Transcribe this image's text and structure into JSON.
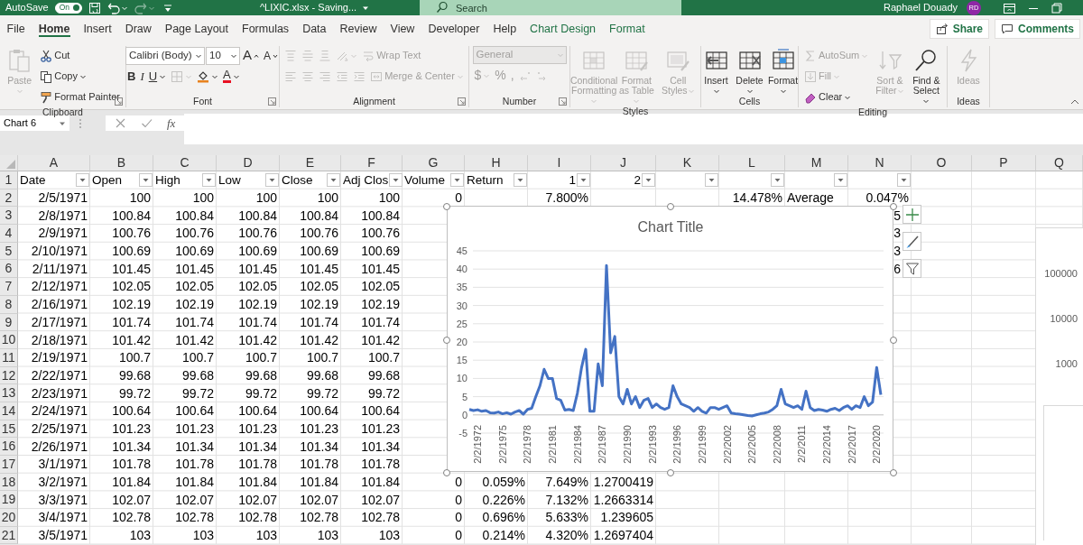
{
  "title_bar": {
    "autosave": {
      "label": "AutoSave",
      "on": true,
      "state_text": "On"
    },
    "quick_access": [
      {
        "kind": "save",
        "disabled": false,
        "dropdown": false
      },
      {
        "kind": "undo",
        "disabled": false,
        "dropdown": true
      },
      {
        "kind": "redo",
        "disabled": true,
        "dropdown": true
      },
      {
        "kind": "customize",
        "disabled": false,
        "dropdown": false
      }
    ],
    "title": "^LIXIC.xlsx - Saving...",
    "search": {
      "placeholder": "Search"
    },
    "user": {
      "name": "Raphael Douady",
      "initials": "RD"
    }
  },
  "tabs": [
    {
      "label": "File",
      "selected": false,
      "kind": "standard"
    },
    {
      "label": "Home",
      "selected": true,
      "kind": "standard"
    },
    {
      "label": "Insert",
      "selected": false,
      "kind": "standard"
    },
    {
      "label": "Draw",
      "selected": false,
      "kind": "standard"
    },
    {
      "label": "Page Layout",
      "selected": false,
      "kind": "standard"
    },
    {
      "label": "Formulas",
      "selected": false,
      "kind": "standard"
    },
    {
      "label": "Data",
      "selected": false,
      "kind": "standard"
    },
    {
      "label": "Review",
      "selected": false,
      "kind": "standard"
    },
    {
      "label": "View",
      "selected": false,
      "kind": "standard"
    },
    {
      "label": "Developer",
      "selected": false,
      "kind": "standard"
    },
    {
      "label": "Help",
      "selected": false,
      "kind": "standard"
    },
    {
      "label": "Chart Design",
      "selected": false,
      "kind": "contextual"
    },
    {
      "label": "Format",
      "selected": false,
      "kind": "contextual"
    }
  ],
  "tab_actions": [
    {
      "kind": "share",
      "label": "Share"
    },
    {
      "kind": "comments",
      "label": "Comments"
    }
  ],
  "ribbon": {
    "groups": [
      {
        "label": "Clipboard",
        "launcher": true,
        "items": [
          {
            "kind": "paste",
            "label": "Paste",
            "disabled": true,
            "dropdown": true
          },
          {
            "kind": "cut",
            "label": "Cut",
            "disabled": false,
            "dropdown": false
          },
          {
            "kind": "copy",
            "label": "Copy",
            "disabled": false,
            "dropdown": true
          },
          {
            "kind": "painter",
            "label": "Format Painter",
            "disabled": false,
            "dropdown": false
          }
        ]
      },
      {
        "label": "Font",
        "launcher": true,
        "items": [
          {
            "kind": "fontname",
            "label": "Calibri (Body)",
            "disabled": false,
            "dropdown": true
          },
          {
            "kind": "fontsize",
            "label": "10",
            "disabled": false,
            "dropdown": true
          },
          {
            "kind": "grow",
            "label": "A",
            "disabled": false,
            "dropdown": false
          },
          {
            "kind": "shrink",
            "label": "A",
            "disabled": false,
            "dropdown": false
          },
          {
            "kind": "bold",
            "label": "B",
            "disabled": false,
            "dropdown": false
          },
          {
            "kind": "italic",
            "label": "I",
            "disabled": false,
            "dropdown": false
          },
          {
            "kind": "underline",
            "label": "U",
            "disabled": false,
            "dropdown": true
          },
          {
            "kind": "borders",
            "disabled": true,
            "dropdown": true
          },
          {
            "kind": "fill",
            "disabled": false,
            "dropdown": true
          },
          {
            "kind": "fontcolor",
            "label": "A",
            "disabled": false,
            "dropdown": true
          }
        ]
      },
      {
        "label": "Alignment",
        "launcher": true,
        "items": [
          {
            "kind": "aligntop",
            "disabled": true,
            "dropdown": false
          },
          {
            "kind": "alignmiddle",
            "disabled": true,
            "dropdown": false
          },
          {
            "kind": "alignbottom",
            "disabled": true,
            "dropdown": false
          },
          {
            "kind": "orientation",
            "disabled": true,
            "dropdown": true
          },
          {
            "kind": "wrap",
            "label": "Wrap Text",
            "disabled": true,
            "dropdown": false
          },
          {
            "kind": "alignleft",
            "disabled": true,
            "dropdown": false
          },
          {
            "kind": "center",
            "disabled": true,
            "dropdown": false
          },
          {
            "kind": "alignright",
            "disabled": true,
            "dropdown": false
          },
          {
            "kind": "outdent",
            "disabled": true,
            "dropdown": false
          },
          {
            "kind": "indent",
            "disabled": true,
            "dropdown": false
          },
          {
            "kind": "merge",
            "label": "Merge & Center",
            "disabled": true,
            "dropdown": true
          }
        ]
      },
      {
        "label": "Number",
        "launcher": true,
        "items": [
          {
            "kind": "format",
            "label": "General",
            "disabled": true,
            "dropdown": true
          },
          {
            "kind": "currency",
            "label": "$",
            "disabled": true,
            "dropdown": true
          },
          {
            "kind": "percent",
            "label": "%",
            "disabled": true,
            "dropdown": false
          },
          {
            "kind": "comma",
            "label": ",",
            "disabled": true,
            "dropdown": false
          },
          {
            "kind": "incdecimal",
            "disabled": true,
            "dropdown": false
          },
          {
            "kind": "decdecimal",
            "disabled": true,
            "dropdown": false
          }
        ]
      },
      {
        "label": "Styles",
        "launcher": false,
        "items": [
          {
            "kind": "conditional",
            "label": "Conditional Formatting",
            "disabled": true,
            "dropdown": true
          },
          {
            "kind": "table",
            "label": "Format as Table",
            "disabled": true,
            "dropdown": true
          },
          {
            "kind": "cellstyles",
            "label": "Cell Styles",
            "disabled": true,
            "dropdown": true
          }
        ]
      },
      {
        "label": "Cells",
        "launcher": false,
        "items": [
          {
            "kind": "insert",
            "label": "Insert",
            "disabled": false,
            "dropdown": true
          },
          {
            "kind": "delete",
            "label": "Delete",
            "disabled": false,
            "dropdown": true
          },
          {
            "kind": "formatcells",
            "label": "Format",
            "disabled": false,
            "dropdown": true
          }
        ]
      },
      {
        "label": "Editing",
        "launcher": false,
        "items": [
          {
            "kind": "autosum",
            "label": "AutoSum",
            "disabled": true,
            "dropdown": true
          },
          {
            "kind": "filldown",
            "label": "Fill",
            "disabled": true,
            "dropdown": true
          },
          {
            "kind": "clear",
            "label": "Clear",
            "disabled": false,
            "dropdown": true
          },
          {
            "kind": "sort",
            "label": "Sort & Filter",
            "disabled": true,
            "dropdown": true
          },
          {
            "kind": "find",
            "label": "Find & Select",
            "disabled": false,
            "dropdown": true
          }
        ]
      },
      {
        "label": "Ideas",
        "launcher": false,
        "items": [
          {
            "kind": "ideas",
            "label": "Ideas",
            "disabled": true,
            "dropdown": false
          }
        ]
      }
    ]
  },
  "formula_bar": {
    "name_box": "Chart 6",
    "function_label": "fx"
  },
  "grid": {
    "columns": [
      "A",
      "B",
      "C",
      "D",
      "E",
      "F",
      "G",
      "H",
      "I",
      "J",
      "K",
      "L",
      "M",
      "N",
      "O",
      "P",
      "Q"
    ],
    "rows": [
      {
        "number": "1",
        "kind": "header",
        "cells": {
          "A": {
            "text": "Date",
            "filter": true
          },
          "B": {
            "text": "Open",
            "filter": true
          },
          "C": {
            "text": "High",
            "filter": true
          },
          "D": {
            "text": "Low",
            "filter": true
          },
          "E": {
            "text": "Close",
            "filter": true
          },
          "F": {
            "text": "Adj Clos",
            "filter": true
          },
          "G": {
            "text": "Volume",
            "filter": true
          },
          "H": {
            "text": "Return",
            "filter": true
          },
          "I": {
            "text": "1",
            "kind": "number",
            "filter": true
          },
          "J": {
            "text": "2",
            "kind": "number",
            "filter": true
          },
          "K": {
            "filter": true
          },
          "L": {
            "filter": true
          },
          "M": {
            "filter": true
          },
          "N": {
            "filter": true
          }
        }
      },
      {
        "number": "2",
        "kind": "data",
        "cells": {
          "A": "2/5/1971",
          "B": "100",
          "C": "100",
          "D": "100",
          "E": "100",
          "F": "100",
          "G": "0",
          "I": "7.800%",
          "L": "14.478%",
          "M": {
            "text": "Average",
            "kind": "text"
          },
          "N": "0.047%"
        }
      },
      {
        "number": "3",
        "kind": "data",
        "cells": {
          "A": "2/8/1971",
          "B": "100.84",
          "C": "100.84",
          "D": "100.84",
          "E": "100.84",
          "F": "100.84",
          "N": "5"
        }
      },
      {
        "number": "4",
        "kind": "data",
        "cells": {
          "A": "2/9/1971",
          "B": "100.76",
          "C": "100.76",
          "D": "100.76",
          "E": "100.76",
          "F": "100.76",
          "N": "3"
        }
      },
      {
        "number": "5",
        "kind": "data",
        "cells": {
          "A": "2/10/1971",
          "B": "100.69",
          "C": "100.69",
          "D": "100.69",
          "E": "100.69",
          "F": "100.69",
          "N": "3"
        }
      },
      {
        "number": "6",
        "kind": "data",
        "cells": {
          "A": "2/11/1971",
          "B": "101.45",
          "C": "101.45",
          "D": "101.45",
          "E": "101.45",
          "F": "101.45",
          "N": "6"
        }
      },
      {
        "number": "7",
        "kind": "data",
        "cells": {
          "A": "2/12/1971",
          "B": "102.05",
          "C": "102.05",
          "D": "102.05",
          "E": "102.05",
          "F": "102.05"
        }
      },
      {
        "number": "8",
        "kind": "data",
        "cells": {
          "A": "2/16/1971",
          "B": "102.19",
          "C": "102.19",
          "D": "102.19",
          "E": "102.19",
          "F": "102.19"
        }
      },
      {
        "number": "9",
        "kind": "data",
        "cells": {
          "A": "2/17/1971",
          "B": "101.74",
          "C": "101.74",
          "D": "101.74",
          "E": "101.74",
          "F": "101.74"
        }
      },
      {
        "number": "10",
        "kind": "data",
        "cells": {
          "A": "2/18/1971",
          "B": "101.42",
          "C": "101.42",
          "D": "101.42",
          "E": "101.42",
          "F": "101.42"
        }
      },
      {
        "number": "11",
        "kind": "data",
        "cells": {
          "A": "2/19/1971",
          "B": "100.7",
          "C": "100.7",
          "D": "100.7",
          "E": "100.7",
          "F": "100.7"
        }
      },
      {
        "number": "12",
        "kind": "data",
        "cells": {
          "A": "2/22/1971",
          "B": "99.68",
          "C": "99.68",
          "D": "99.68",
          "E": "99.68",
          "F": "99.68"
        }
      },
      {
        "number": "13",
        "kind": "data",
        "cells": {
          "A": "2/23/1971",
          "B": "99.72",
          "C": "99.72",
          "D": "99.72",
          "E": "99.72",
          "F": "99.72"
        }
      },
      {
        "number": "14",
        "kind": "data",
        "cells": {
          "A": "2/24/1971",
          "B": "100.64",
          "C": "100.64",
          "D": "100.64",
          "E": "100.64",
          "F": "100.64"
        }
      },
      {
        "number": "15",
        "kind": "data",
        "cells": {
          "A": "2/25/1971",
          "B": "101.23",
          "C": "101.23",
          "D": "101.23",
          "E": "101.23",
          "F": "101.23"
        }
      },
      {
        "number": "16",
        "kind": "data",
        "cells": {
          "A": "2/26/1971",
          "B": "101.34",
          "C": "101.34",
          "D": "101.34",
          "E": "101.34",
          "F": "101.34"
        }
      },
      {
        "number": "17",
        "kind": "data",
        "cells": {
          "A": "3/1/1971",
          "B": "101.78",
          "C": "101.78",
          "D": "101.78",
          "E": "101.78",
          "F": "101.78"
        }
      },
      {
        "number": "18",
        "kind": "data",
        "cells": {
          "A": "3/2/1971",
          "B": "101.84",
          "C": "101.84",
          "D": "101.84",
          "E": "101.84",
          "F": "101.84",
          "G": "0",
          "H": "0.059%",
          "I": "7.649%",
          "J": "1.2700419"
        }
      },
      {
        "number": "19",
        "kind": "data",
        "cells": {
          "A": "3/3/1971",
          "B": "102.07",
          "C": "102.07",
          "D": "102.07",
          "E": "102.07",
          "F": "102.07",
          "G": "0",
          "H": "0.226%",
          "I": "7.132%",
          "J": "1.2663314"
        }
      },
      {
        "number": "20",
        "kind": "data",
        "cells": {
          "A": "3/4/1971",
          "B": "102.78",
          "C": "102.78",
          "D": "102.78",
          "E": "102.78",
          "F": "102.78",
          "G": "0",
          "H": "0.696%",
          "I": "5.633%",
          "J": "1.239605"
        }
      },
      {
        "number": "21",
        "kind": "data",
        "cells": {
          "A": "3/5/1971",
          "B": "103",
          "C": "103",
          "D": "103",
          "E": "103",
          "F": "103",
          "G": "0",
          "H": "0.214%",
          "I": "4.320%",
          "J": "1.2697404"
        }
      }
    ]
  },
  "chart": {
    "selected": true,
    "chart_data": {
      "type": "line",
      "title": "Chart Title",
      "categories": [
        null,
        null,
        "2/2/1972",
        null,
        null,
        null,
        null,
        null,
        "2/2/1975",
        null,
        null,
        null,
        null,
        null,
        "2/2/1978",
        null,
        null,
        null,
        null,
        null,
        "2/2/1981",
        null,
        null,
        null,
        null,
        null,
        "2/2/1984",
        null,
        null,
        null,
        null,
        null,
        "2/2/1987",
        null,
        null,
        null,
        null,
        null,
        "2/2/1990",
        null,
        null,
        null,
        null,
        null,
        "2/2/1993",
        null,
        null,
        null,
        null,
        null,
        "2/2/1996",
        null,
        null,
        null,
        null,
        null,
        "2/2/1999",
        null,
        null,
        null,
        null,
        null,
        "2/2/2002",
        null,
        null,
        null,
        null,
        null,
        "2/2/2005",
        null,
        null,
        null,
        null,
        null,
        "2/2/2008",
        null,
        null,
        null,
        null,
        null,
        "2/2/2011",
        null,
        null,
        null,
        null,
        null,
        "2/2/2014",
        null,
        null,
        null,
        null,
        null,
        "2/2/2017",
        null,
        null,
        null,
        null,
        null,
        "2/2/2020",
        null
      ],
      "series": [
        {
          "color": "#4472c4",
          "values": [
            1.5,
            1.2,
            1.4,
            1.0,
            1.2,
            0.6,
            0.5,
            0.8,
            0.3,
            0.6,
            0.2,
            0.8,
            1.2,
            0.2,
            1.5,
            1.8,
            5,
            8,
            12.5,
            10,
            10,
            4.5,
            4,
            1.3,
            1.5,
            1.2,
            6,
            13,
            18,
            1,
            1,
            14,
            8,
            41,
            17,
            21.5,
            5,
            3,
            7,
            3,
            5,
            2,
            4,
            4.5,
            2,
            3,
            2,
            1.5,
            2,
            8,
            5,
            3,
            2.5,
            2,
            1,
            2,
            1,
            0.5,
            2,
            2,
            1.5,
            2,
            2.5,
            0.5,
            0.3,
            0.2,
            0,
            -0.2,
            -0.3,
            0,
            0.3,
            0.5,
            0.8,
            1.5,
            2.5,
            7,
            3,
            2.5,
            2,
            2.5,
            1.5,
            6.5,
            2,
            1.2,
            1.5,
            1.3,
            1,
            1.5,
            1.8,
            1.2,
            2,
            2.5,
            1.5,
            2.5,
            2,
            5,
            2.5,
            3.5,
            13,
            5.5
          ]
        }
      ],
      "yticks": [
        {
          "value": -5,
          "label": "-5"
        },
        {
          "value": 0,
          "label": "0"
        },
        {
          "value": 5,
          "label": "5"
        },
        {
          "value": 10,
          "label": "10"
        },
        {
          "value": 15,
          "label": "15"
        },
        {
          "value": 20,
          "label": "20"
        },
        {
          "value": 25,
          "label": "25"
        },
        {
          "value": 30,
          "label": "30"
        },
        {
          "value": 35,
          "label": "35"
        },
        {
          "value": 40,
          "label": "40"
        },
        {
          "value": 45,
          "label": "45"
        }
      ],
      "ylim": [
        -5,
        45
      ],
      "grid": true
    }
  },
  "side_chart": {
    "axis_labels": [
      "100000",
      "10000",
      "1000"
    ]
  }
}
